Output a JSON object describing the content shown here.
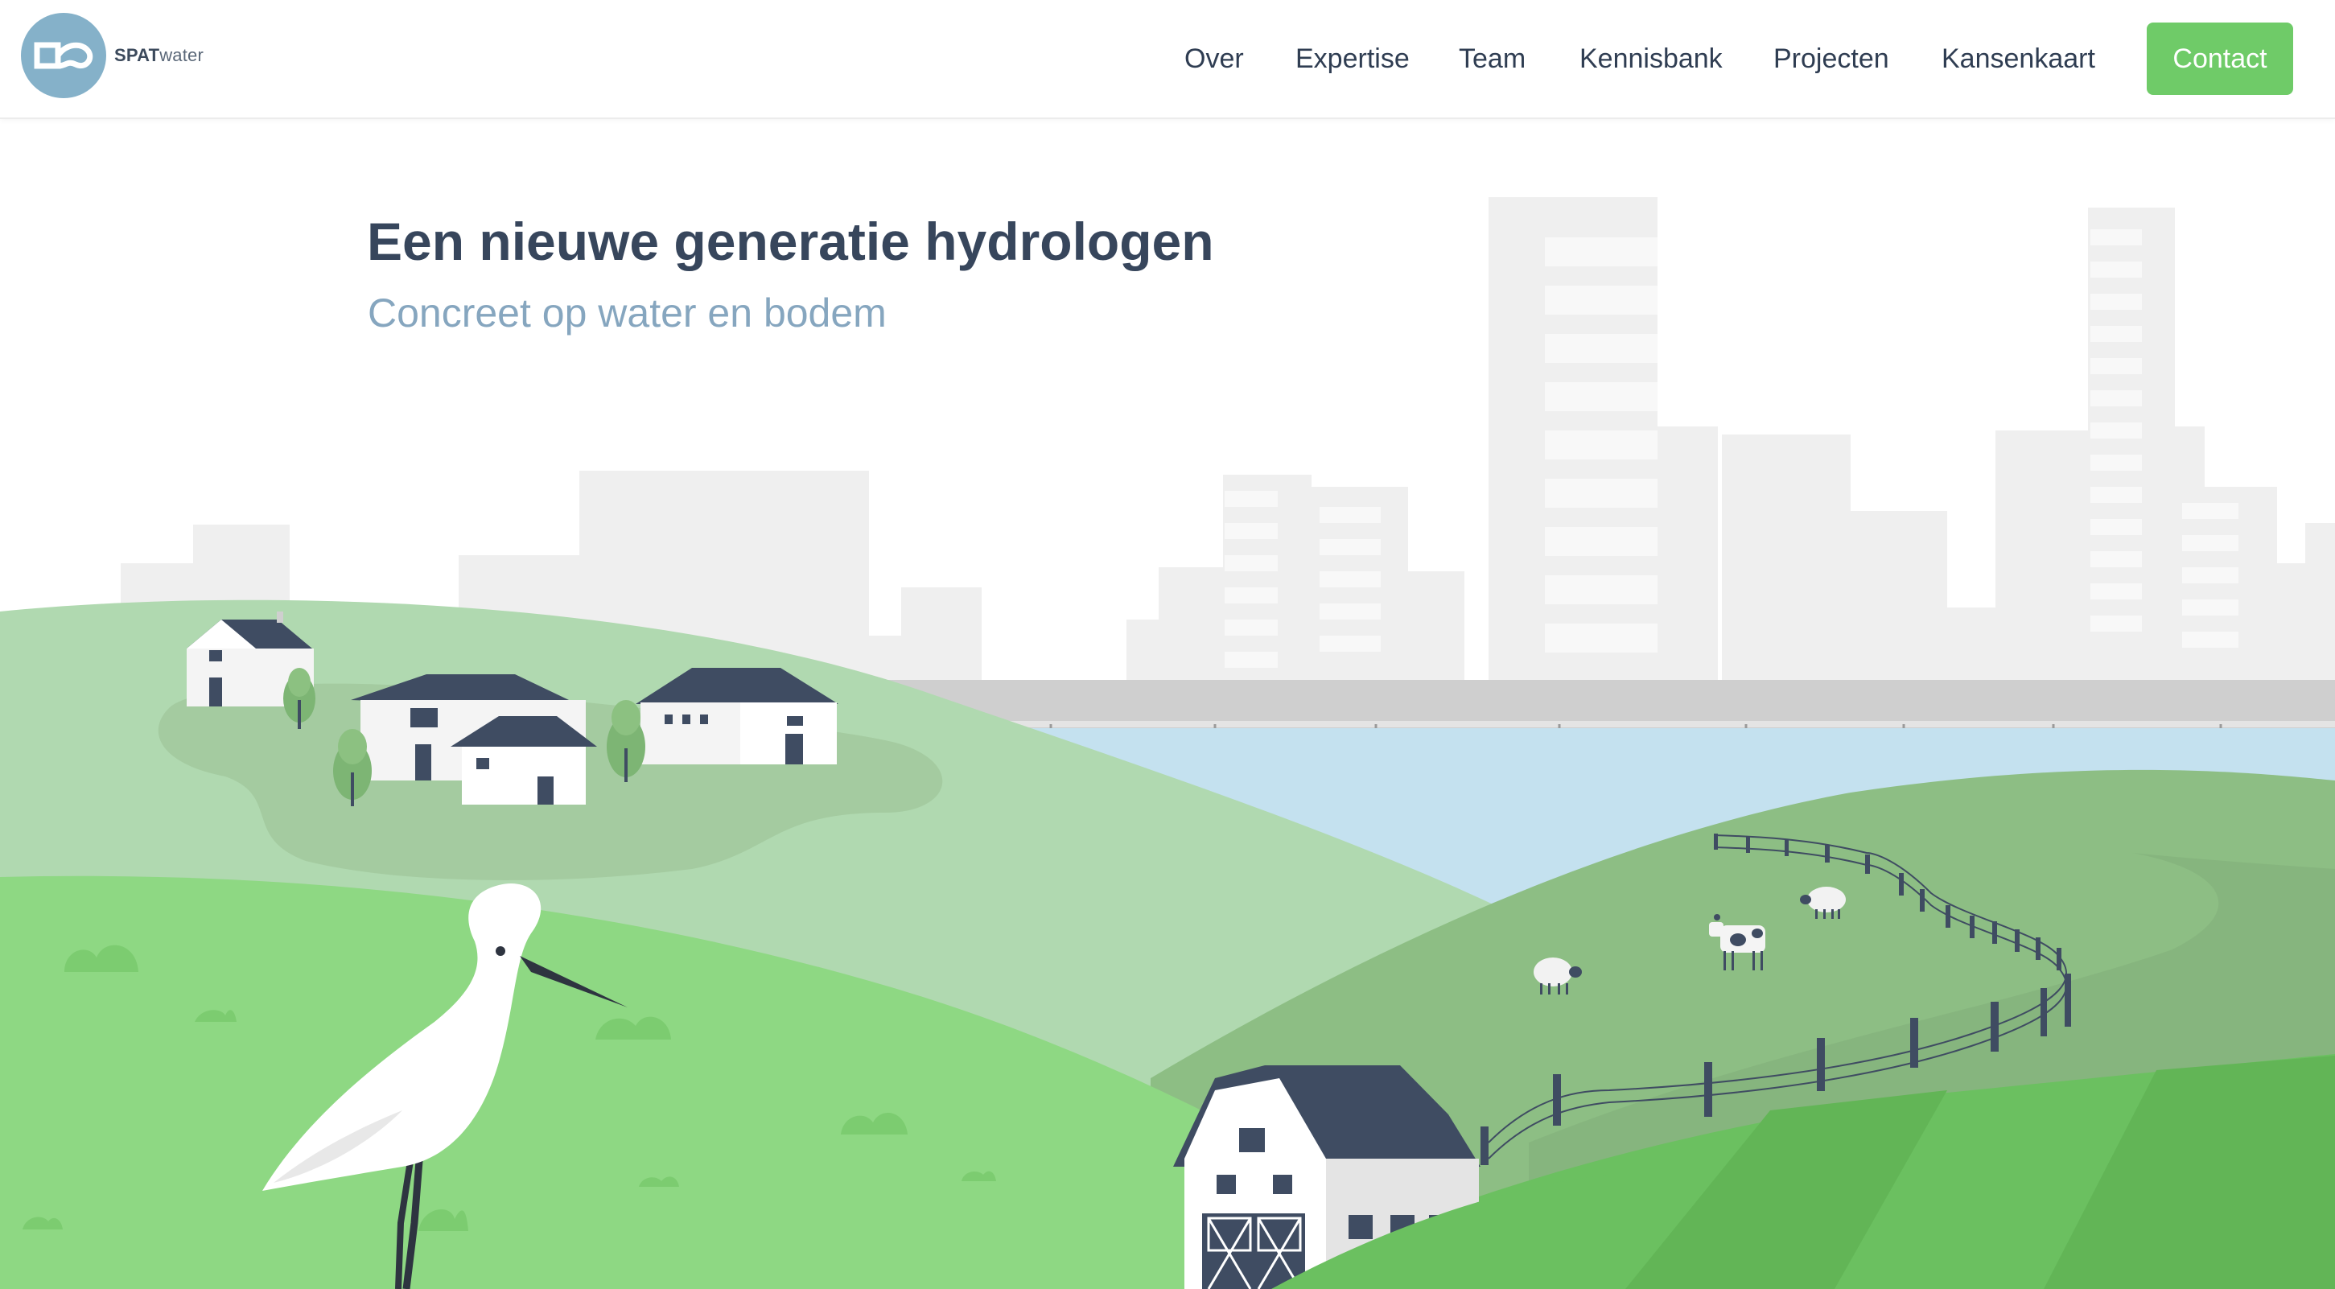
{
  "brand": {
    "name_bold": "SPAT",
    "name_light": "water",
    "logo_color": "#85b1c9"
  },
  "nav": {
    "items": [
      "Over",
      "Expertise",
      "Team",
      "Kennisbank",
      "Projecten",
      "Kansenkaart"
    ],
    "contact_label": "Contact",
    "contact_color": "#6fcb68"
  },
  "hero": {
    "title": "Een nieuwe generatie hydrologen",
    "subtitle": "Concreet op water en bodem"
  },
  "illustration": {
    "icons": [
      "heron-icon",
      "farmhouse-icon",
      "barn-icon",
      "cow-icon",
      "sheep-icon",
      "tree-icon",
      "fence-icon",
      "city-skyline"
    ],
    "colors": {
      "skyline": "#efefef",
      "river": "#c4e1ef",
      "hill_light": "#b0d9b0",
      "hill_mid": "#8dbe84",
      "meadow": "#8ed883",
      "field": "#6bc060",
      "roof": "#3f4c62"
    }
  }
}
